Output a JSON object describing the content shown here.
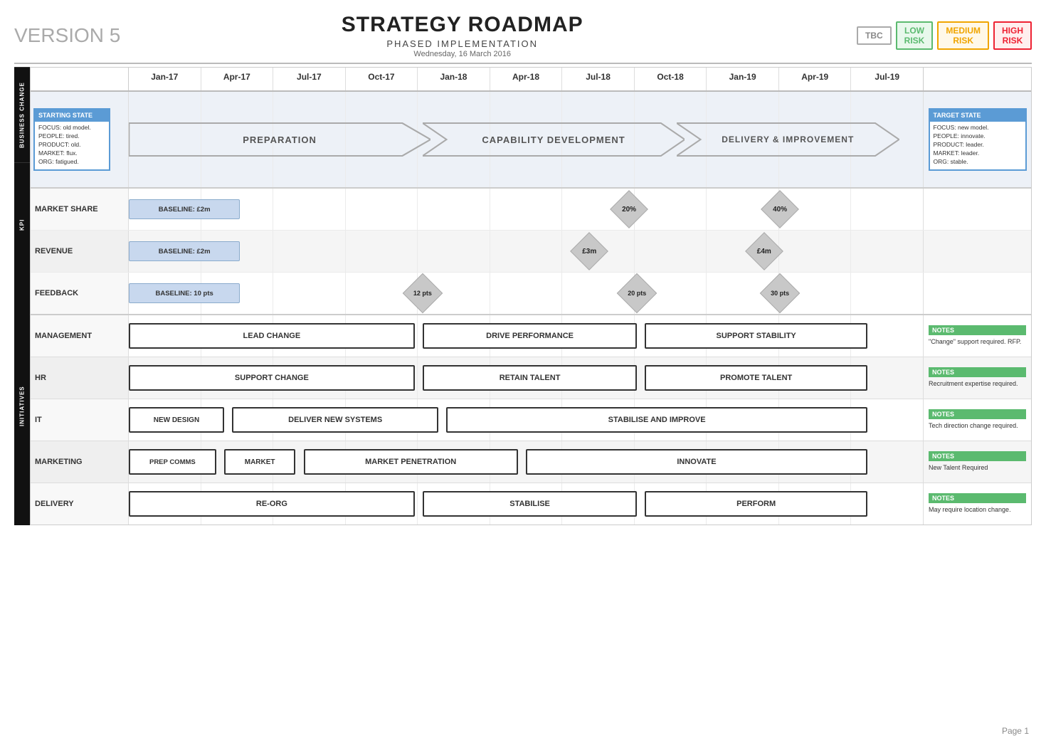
{
  "page": {
    "title": "STRATEGY ROADMAP",
    "subtitle": "PHASED IMPLEMENTATION",
    "date": "Wednesday, 16 March 2016",
    "version": "VERSION 5",
    "page_num": "Page 1"
  },
  "legend": {
    "tbc": "TBC",
    "low": {
      "label": "LOW\nRISK",
      "line1": "LOW",
      "line2": "RISK"
    },
    "medium": {
      "label": "MEDIUM\nRISK",
      "line1": "MEDIUM",
      "line2": "RISK"
    },
    "high": {
      "label": "HIGH\nRISK",
      "line1": "HIGH",
      "line2": "RISK"
    }
  },
  "timeline": {
    "dates": [
      "Jan-17",
      "Apr-17",
      "Jul-17",
      "Oct-17",
      "Jan-18",
      "Apr-18",
      "Jul-18",
      "Oct-18",
      "Jan-19",
      "Apr-19",
      "Jul-19"
    ]
  },
  "sections": {
    "business_change": {
      "label": "BUSINESS CHANGE",
      "starting_state": {
        "header": "STARTING STATE",
        "lines": [
          "FOCUS: old model.",
          "PEOPLE: tired.",
          "PRODUCT: old.",
          "MARKET: flux.",
          "ORG: fatigued."
        ]
      },
      "target_state": {
        "header": "TARGET STATE",
        "lines": [
          "FOCUS: new model.",
          "PEOPLE: innovate.",
          "PRODUCT: leader.",
          "MARKET: leader.",
          "ORG: stable."
        ]
      },
      "arrows": [
        {
          "label": "PREPARATION",
          "left_pct": 14,
          "width_pct": 27
        },
        {
          "label": "CAPABILITY DEVELOPMENT",
          "left_pct": 41,
          "width_pct": 28
        },
        {
          "label": "DELIVERY & IMPROVEMENT",
          "left_pct": 69,
          "width_pct": 24
        }
      ]
    },
    "kpi": {
      "label": "KPI",
      "rows": [
        {
          "name": "MARKET SHARE",
          "baseline": {
            "label": "BASELINE: £2m",
            "left_pct": 14,
            "width_pct": 12
          },
          "diamonds": [
            {
              "label": "20%",
              "left_pct": 63
            },
            {
              "label": "40%",
              "left_pct": 82
            }
          ]
        },
        {
          "name": "REVENUE",
          "baseline": {
            "label": "BASELINE: £2m",
            "left_pct": 14,
            "width_pct": 12
          },
          "diamonds": [
            {
              "label": "£3m",
              "left_pct": 58
            },
            {
              "label": "£4m",
              "left_pct": 80
            }
          ]
        },
        {
          "name": "FEEDBACK",
          "baseline": {
            "label": "BASELINE: 10 pts",
            "left_pct": 14,
            "width_pct": 12
          },
          "diamonds": [
            {
              "label": "12 pts",
              "left_pct": 37
            },
            {
              "label": "20 pts",
              "left_pct": 64
            },
            {
              "label": "30 pts",
              "left_pct": 82
            }
          ]
        }
      ]
    },
    "initiatives": {
      "label": "INITIATIVES",
      "rows": [
        {
          "name": "MANAGEMENT",
          "items": [
            {
              "label": "LEAD CHANGE",
              "left_pct": 14,
              "width_pct": 25,
              "color": "orange"
            },
            {
              "label": "DRIVE PERFORMANCE",
              "left_pct": 40,
              "width_pct": 26,
              "color": "red"
            },
            {
              "label": "SUPPORT STABILITY",
              "left_pct": 67,
              "width_pct": 26,
              "color": "orange"
            }
          ],
          "notes": {
            "tag": "NOTES",
            "text": "\"Change\" support required. RFP."
          }
        },
        {
          "name": "HR",
          "items": [
            {
              "label": "SUPPORT CHANGE",
              "left_pct": 14,
              "width_pct": 25,
              "color": "orange"
            },
            {
              "label": "RETAIN TALENT",
              "left_pct": 40,
              "width_pct": 26,
              "color": "red"
            },
            {
              "label": "PROMOTE TALENT",
              "left_pct": 67,
              "width_pct": 26,
              "color": "orange"
            }
          ],
          "notes": {
            "tag": "NOTES",
            "text": "Recruitment expertise required."
          }
        },
        {
          "name": "IT",
          "items": [
            {
              "label": "NEW DESIGN",
              "left_pct": 14,
              "width_pct": 9,
              "color": "green"
            },
            {
              "label": "DELIVER NEW SYSTEMS",
              "left_pct": 24,
              "width_pct": 25,
              "color": "orange"
            },
            {
              "label": "STABILISE AND IMPROVE",
              "left_pct": 50,
              "width_pct": 43,
              "color": "green"
            }
          ],
          "notes": {
            "tag": "NOTES",
            "text": "Tech direction change required."
          }
        },
        {
          "name": "MARKETING",
          "items": [
            {
              "label": "PREP COMMS",
              "left_pct": 14,
              "width_pct": 9,
              "color": "orange"
            },
            {
              "label": "MARKET",
              "left_pct": 24,
              "width_pct": 8,
              "color": "orange"
            },
            {
              "label": "MARKET PENETRATION",
              "left_pct": 33,
              "width_pct": 26,
              "color": "red"
            },
            {
              "label": "INNOVATE",
              "left_pct": 60,
              "width_pct": 33,
              "color": "green"
            }
          ],
          "notes": {
            "tag": "NOTES",
            "text": "New Talent Required"
          }
        },
        {
          "name": "DELIVERY",
          "items": [
            {
              "label": "RE-ORG",
              "left_pct": 14,
              "width_pct": 25,
              "color": "red"
            },
            {
              "label": "STABILISE",
              "left_pct": 40,
              "width_pct": 26,
              "color": "red"
            },
            {
              "label": "PERFORM",
              "left_pct": 67,
              "width_pct": 26,
              "color": "green"
            }
          ],
          "notes": {
            "tag": "NOTES",
            "text": "May require location change."
          }
        }
      ]
    }
  }
}
